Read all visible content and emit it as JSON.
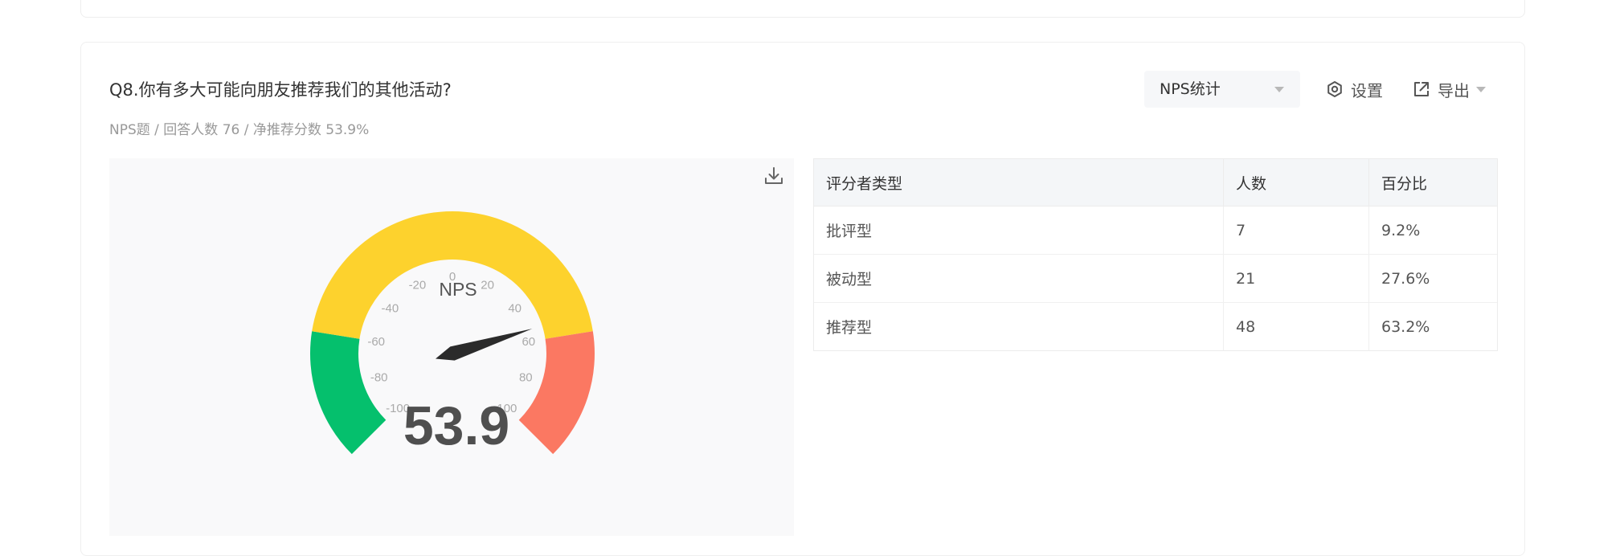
{
  "question": {
    "title": "Q8.你有多大可能向朋友推荐我们的其他活动?",
    "subtitle": "NPS题 / 回答人数 76 / 净推荐分数 53.9%"
  },
  "toolbar": {
    "select_value": "NPS统计",
    "settings_label": "设置",
    "export_label": "导出"
  },
  "icons": {
    "download": "download-icon",
    "settings": "gear-icon",
    "export": "external-link-icon",
    "dropdown": "chevron-down-icon"
  },
  "colors": {
    "detractor": "#FB7862",
    "passive": "#FDD22D",
    "promoter": "#05C06D",
    "needle": "#2B2B2B",
    "value_text": "#4F4F4F"
  },
  "chart_data": {
    "type": "gauge",
    "title": "NPS",
    "value": 53.9,
    "value_label": "53.9",
    "min": -100,
    "max": 100,
    "ticks": [
      "-100",
      "-80",
      "-60",
      "-40",
      "-20",
      "0",
      "20",
      "40",
      "60",
      "80",
      "100"
    ],
    "bands": [
      {
        "from": -100,
        "to": -60,
        "color": "#05C06D"
      },
      {
        "from": -60,
        "to": 60,
        "color": "#FDD22D"
      },
      {
        "from": 60,
        "to": 100,
        "color": "#FB7862"
      }
    ]
  },
  "table": {
    "headers": [
      "评分者类型",
      "人数",
      "百分比"
    ],
    "rows": [
      [
        "批评型",
        "7",
        "9.2%"
      ],
      [
        "被动型",
        "21",
        "27.6%"
      ],
      [
        "推荐型",
        "48",
        "63.2%"
      ]
    ]
  }
}
